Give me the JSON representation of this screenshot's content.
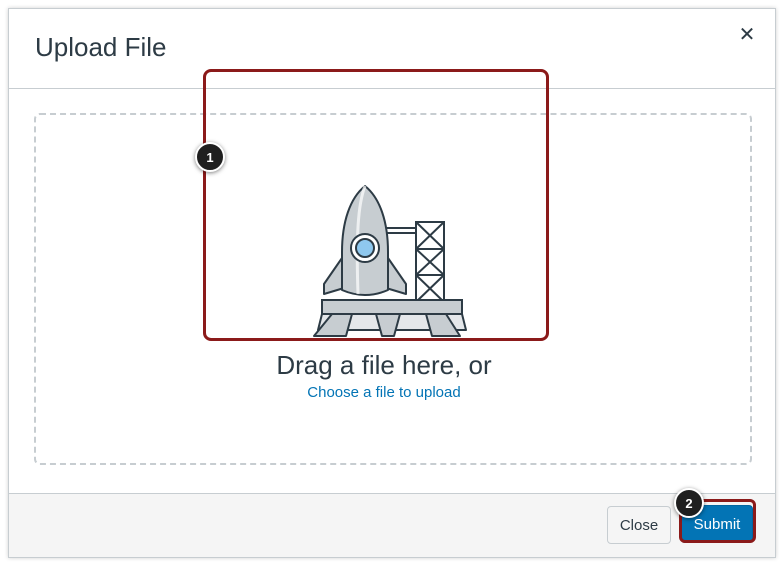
{
  "modal": {
    "title": "Upload File",
    "close_glyph": "✕"
  },
  "dropzone": {
    "headline": "Drag a file here, or",
    "link_text": "Choose a file to upload",
    "illustration": "rocket-launch-illustration"
  },
  "callouts": {
    "first": "1",
    "second": "2"
  },
  "footer": {
    "close_label": "Close",
    "submit_label": "Submit"
  },
  "colors": {
    "link": "#0374b5",
    "primary_button": "#0374b5",
    "highlight": "#8b1a1a",
    "text": "#2d3b45"
  },
  "icons": [
    "close-icon",
    "rocket-icon"
  ]
}
